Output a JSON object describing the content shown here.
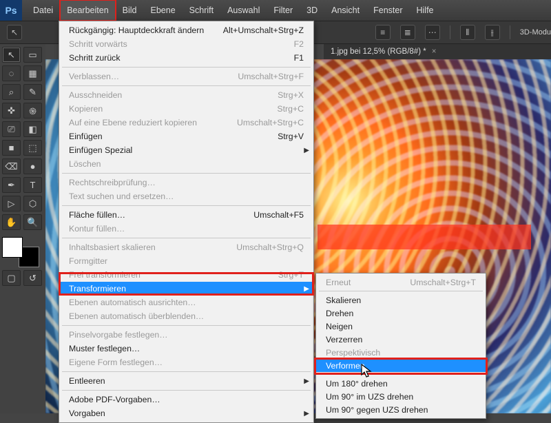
{
  "menubar": {
    "items": [
      "Datei",
      "Bearbeiten",
      "Bild",
      "Ebene",
      "Schrift",
      "Auswahl",
      "Filter",
      "3D",
      "Ansicht",
      "Fenster",
      "Hilfe"
    ],
    "active_index": 1
  },
  "optionsbar": {
    "mode_label": "3D-Modu"
  },
  "doctab": {
    "title": "1.jpg bei 12,5% (RGB/8#) *",
    "close": "×"
  },
  "tools": {
    "icons": [
      "↖",
      "▭",
      "◌",
      "▦",
      "⌕",
      "✎",
      "✜",
      "֍",
      "⎚",
      "◧",
      "■",
      "⬚",
      "⌫",
      "●",
      "✒",
      "T",
      "▷",
      "⬡",
      "✋",
      "🔍"
    ],
    "mask": "▢",
    "quick": "↺"
  },
  "edit_menu": {
    "items": [
      {
        "label": "Rückgängig: Hauptdeckkraft ändern",
        "short": "Alt+Umschalt+Strg+Z"
      },
      {
        "label": "Schritt vorwärts",
        "short": "F2",
        "disabled": true
      },
      {
        "label": "Schritt zurück",
        "short": "F1"
      },
      "hr",
      {
        "label": "Verblassen…",
        "short": "Umschalt+Strg+F",
        "disabled": true
      },
      "hr",
      {
        "label": "Ausschneiden",
        "short": "Strg+X",
        "disabled": true
      },
      {
        "label": "Kopieren",
        "short": "Strg+C",
        "disabled": true
      },
      {
        "label": "Auf eine Ebene reduziert kopieren",
        "short": "Umschalt+Strg+C",
        "disabled": true
      },
      {
        "label": "Einfügen",
        "short": "Strg+V"
      },
      {
        "label": "Einfügen Spezial",
        "short": "",
        "sub": true
      },
      {
        "label": "Löschen",
        "short": "",
        "disabled": true
      },
      "hr",
      {
        "label": "Rechtschreibprüfung…",
        "short": "",
        "disabled": true
      },
      {
        "label": "Text suchen und ersetzen…",
        "short": "",
        "disabled": true
      },
      "hr",
      {
        "label": "Fläche füllen…",
        "short": "Umschalt+F5"
      },
      {
        "label": "Kontur füllen…",
        "short": "",
        "disabled": true
      },
      "hr",
      {
        "label": "Inhaltsbasiert skalieren",
        "short": "Umschalt+Strg+Q",
        "disabled": true
      },
      {
        "label": "Formgitter",
        "short": "",
        "disabled": true
      },
      {
        "label": "Frei transformieren",
        "short": "Strg+T",
        "disabled": true
      },
      {
        "label": "Transformieren",
        "short": "",
        "sub": true,
        "hover": true
      },
      {
        "label": "Ebenen automatisch ausrichten…",
        "short": "",
        "disabled": true
      },
      {
        "label": "Ebenen automatisch überblenden…",
        "short": "",
        "disabled": true
      },
      "hr",
      {
        "label": "Pinselvorgabe festlegen…",
        "short": "",
        "disabled": true
      },
      {
        "label": "Muster festlegen…",
        "short": ""
      },
      {
        "label": "Eigene Form festlegen…",
        "short": "",
        "disabled": true
      },
      "hr",
      {
        "label": "Entleeren",
        "short": "",
        "sub": true
      },
      "hr",
      {
        "label": "Adobe PDF-Vorgaben…",
        "short": ""
      },
      {
        "label": "Vorgaben",
        "short": "",
        "sub": true
      }
    ]
  },
  "transform_submenu": {
    "items": [
      {
        "label": "Erneut",
        "short": "Umschalt+Strg+T",
        "disabled": true
      },
      "hr",
      {
        "label": "Skalieren"
      },
      {
        "label": "Drehen"
      },
      {
        "label": "Neigen"
      },
      {
        "label": "Verzerren"
      },
      {
        "label": "Perspektivisch",
        "disabled": true
      },
      {
        "label": "Verformen",
        "hover": true
      },
      "hr",
      {
        "label": "Um 180° drehen"
      },
      {
        "label": "Um 90° im UZS drehen"
      },
      {
        "label": "Um 90° gegen UZS drehen"
      }
    ]
  }
}
